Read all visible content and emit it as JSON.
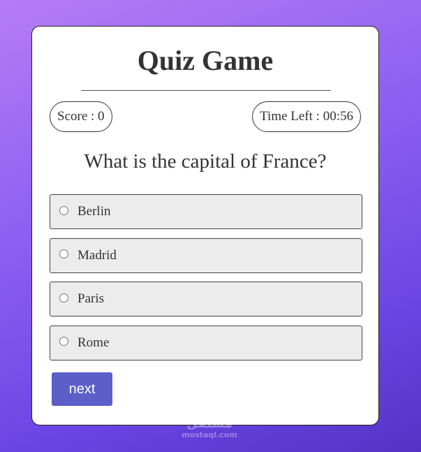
{
  "quiz": {
    "title": "Quiz Game",
    "score_text": "Score : 0",
    "timer_text": "Time Left : 00:56",
    "question": "What is the capital of France?",
    "options": [
      "Berlin",
      "Madrid",
      "Paris",
      "Rome"
    ],
    "next_label": "next"
  },
  "watermark": {
    "logo": "مستقل",
    "url": "mostaql.com"
  },
  "colors": {
    "background_gradient": [
      "#b47cf6",
      "#6b45e4",
      "#5533c6"
    ],
    "card": "#ffffff",
    "option_bg": "#ececec",
    "next_button": "#5b5fc7",
    "text": "#333333"
  },
  "icons": {
    "option_selector": "radio-button-icon"
  }
}
